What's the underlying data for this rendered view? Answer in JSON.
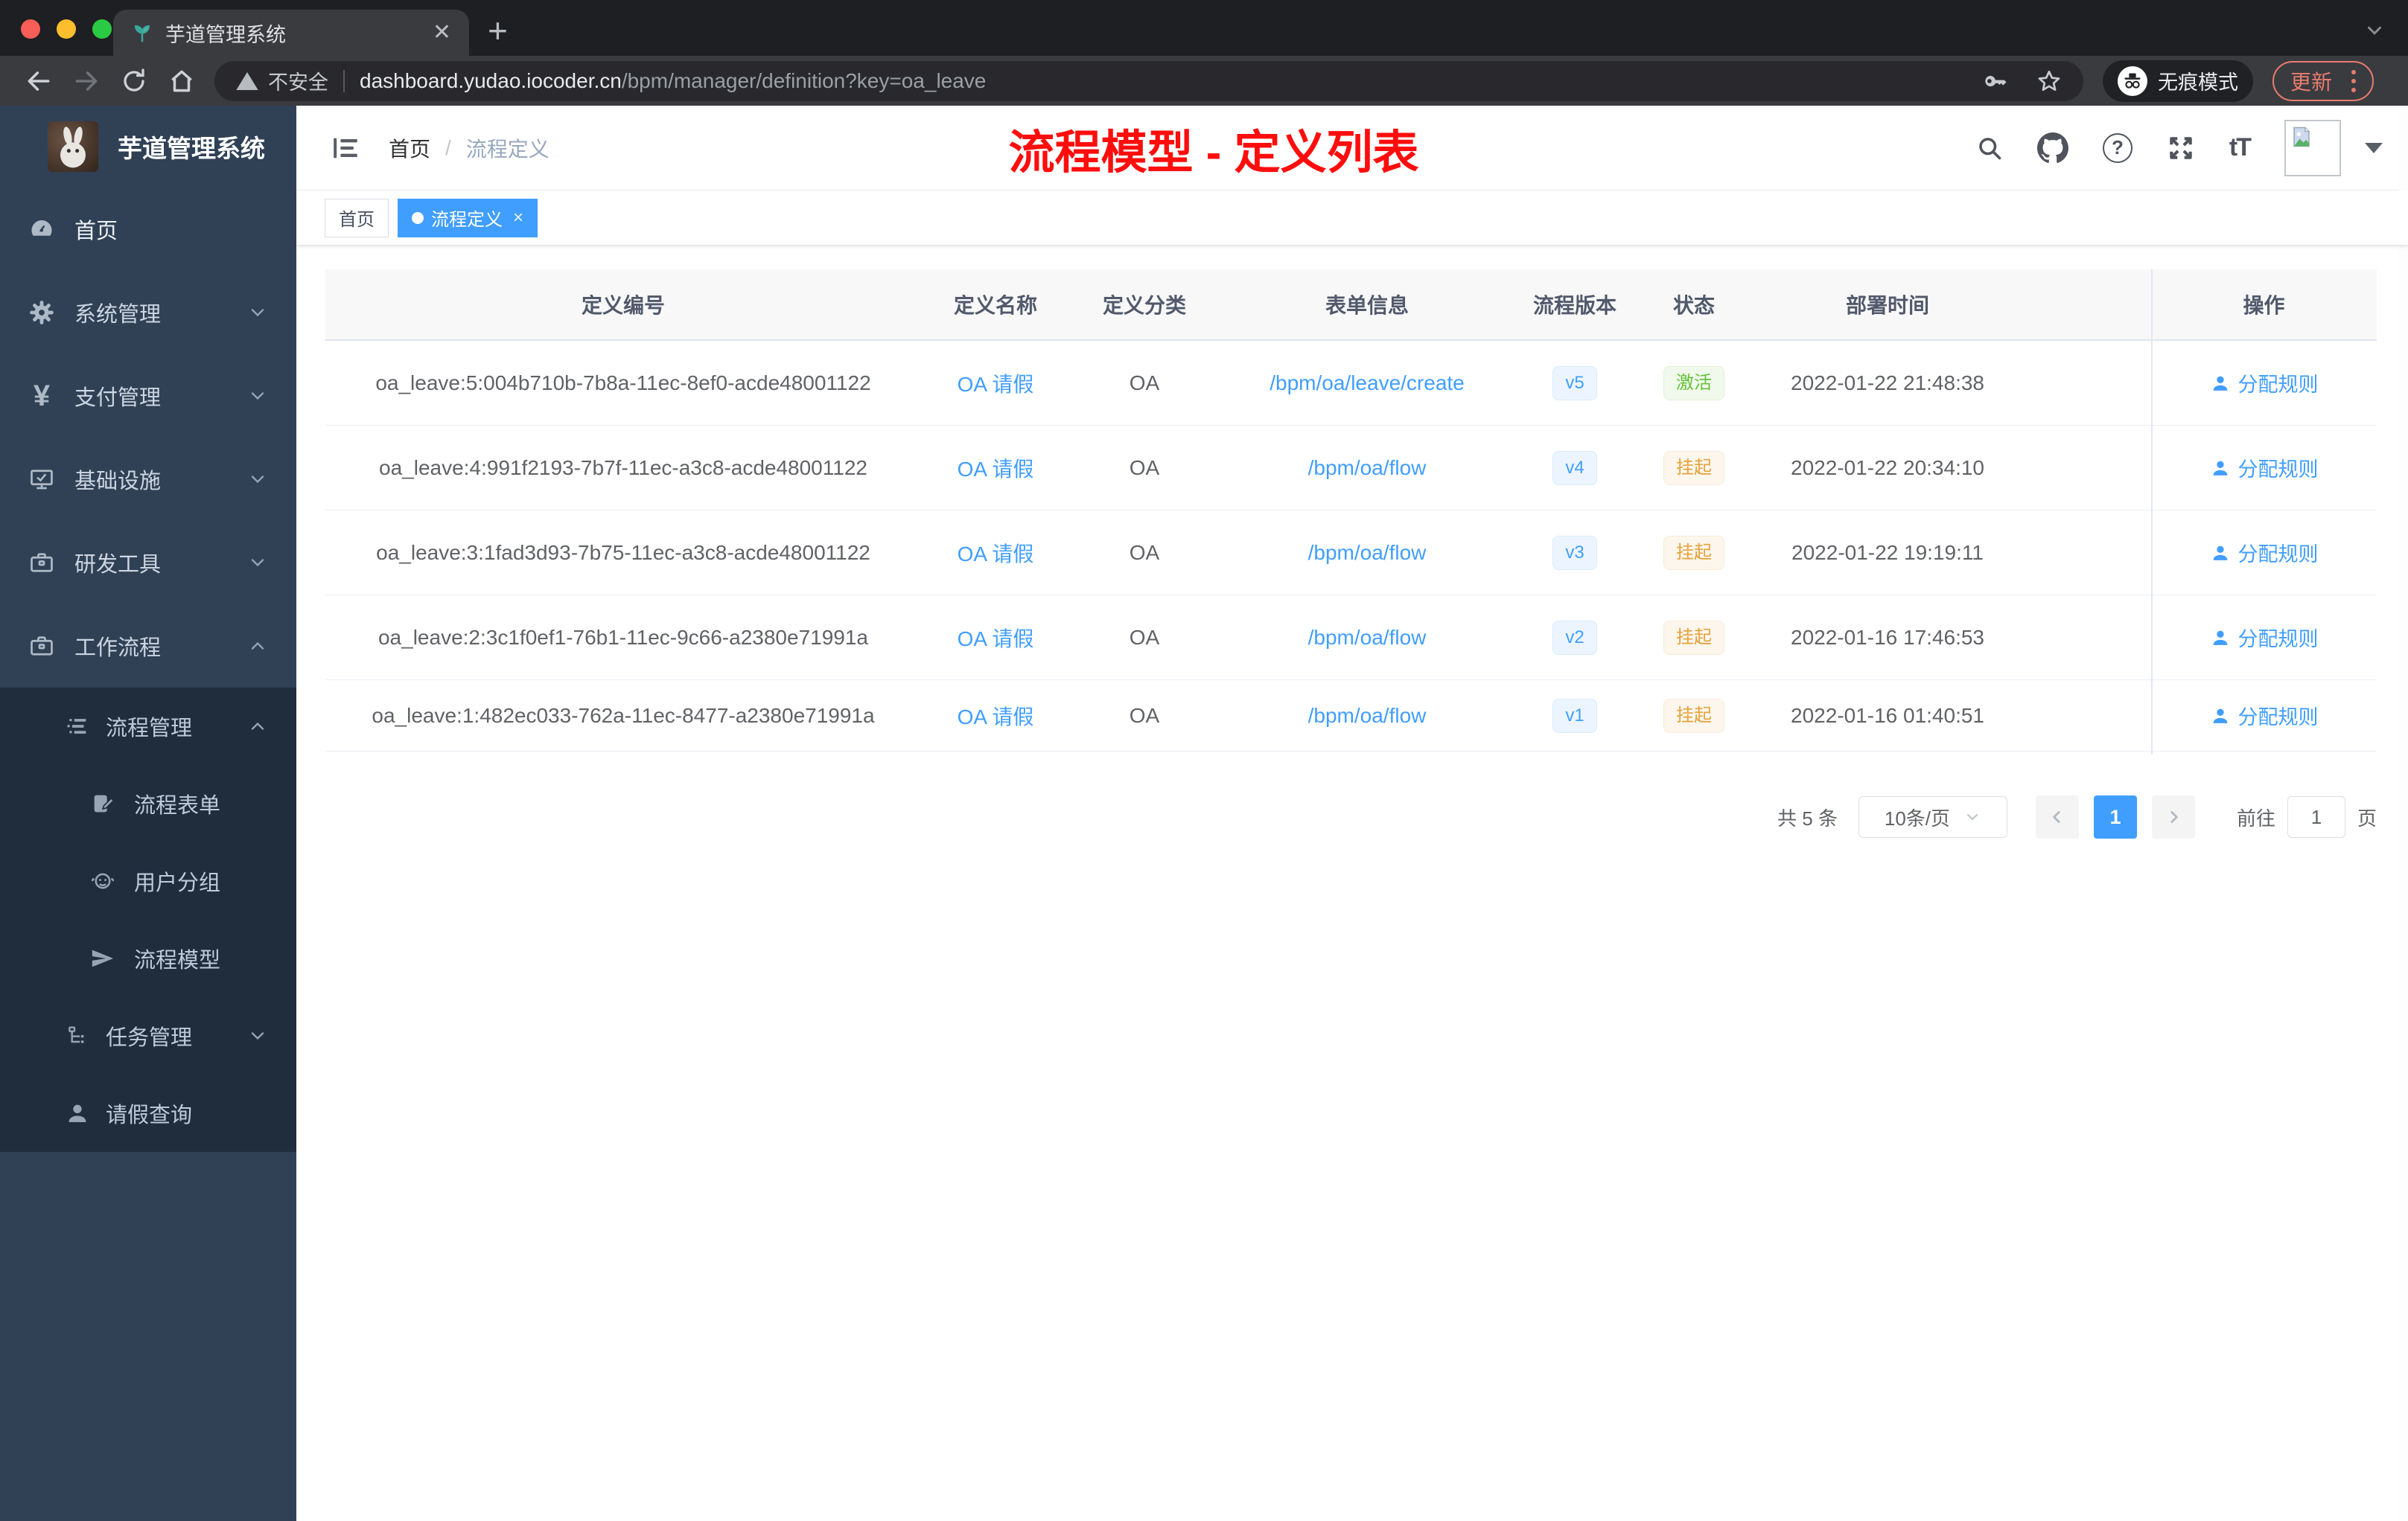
{
  "browser": {
    "tab_title": "芋道管理系统",
    "tab_close": "✕",
    "new_tab": "+",
    "security_label": "不安全",
    "url_host": "dashboard.yudao.iocoder.cn",
    "url_path": "/bpm/manager/definition?key=oa_leave",
    "incognito_label": "无痕模式",
    "update_label": "更新"
  },
  "sidebar": {
    "title": "芋道管理系统",
    "items": [
      {
        "label": "首页",
        "icon": "dashboard-icon",
        "chevron": "none"
      },
      {
        "label": "系统管理",
        "icon": "gear-icon",
        "chevron": "down"
      },
      {
        "label": "支付管理",
        "icon": "yuan-icon",
        "chevron": "down",
        "icon_glyph": "¥"
      },
      {
        "label": "基础设施",
        "icon": "monitor-icon",
        "chevron": "down"
      },
      {
        "label": "研发工具",
        "icon": "toolbox-icon",
        "chevron": "down"
      },
      {
        "label": "工作流程",
        "icon": "toolbox-icon",
        "chevron": "up"
      }
    ],
    "submenu": [
      {
        "label": "流程管理",
        "icon": "stream-icon",
        "chevron": "up"
      },
      {
        "label": "流程表单",
        "icon": "form-icon"
      },
      {
        "label": "用户分组",
        "icon": "user-group-icon"
      },
      {
        "label": "流程模型",
        "icon": "send-icon"
      },
      {
        "label": "任务管理",
        "icon": "tree-icon",
        "chevron": "down"
      },
      {
        "label": "请假查询",
        "icon": "person-icon"
      }
    ]
  },
  "header": {
    "breadcrumb": {
      "home": "首页",
      "separator": "/",
      "current": "流程定义"
    },
    "annotation": "流程模型 - 定义列表",
    "font_size_icon_label": "tT"
  },
  "tags": {
    "home": "首页",
    "active": "流程定义",
    "close": "×"
  },
  "table": {
    "columns": [
      "定义编号",
      "定义名称",
      "定义分类",
      "表单信息",
      "流程版本",
      "状态",
      "部署时间",
      "操作"
    ],
    "action_label": "分配规则",
    "rows": [
      {
        "id": "oa_leave:5:004b710b-7b8a-11ec-8ef0-acde48001122",
        "name": "OA 请假",
        "category": "OA",
        "form": "/bpm/oa/leave/create",
        "version": "v5",
        "status": "激活",
        "status_type": "active",
        "time": "2022-01-22 21:48:38"
      },
      {
        "id": "oa_leave:4:991f2193-7b7f-11ec-a3c8-acde48001122",
        "name": "OA 请假",
        "category": "OA",
        "form": "/bpm/oa/flow",
        "version": "v4",
        "status": "挂起",
        "status_type": "suspended",
        "time": "2022-01-22 20:34:10"
      },
      {
        "id": "oa_leave:3:1fad3d93-7b75-11ec-a3c8-acde48001122",
        "name": "OA 请假",
        "category": "OA",
        "form": "/bpm/oa/flow",
        "version": "v3",
        "status": "挂起",
        "status_type": "suspended",
        "time": "2022-01-22 19:19:11"
      },
      {
        "id": "oa_leave:2:3c1f0ef1-76b1-11ec-9c66-a2380e71991a",
        "name": "OA 请假",
        "category": "OA",
        "form": "/bpm/oa/flow",
        "version": "v2",
        "status": "挂起",
        "status_type": "suspended",
        "time": "2022-01-16 17:46:53"
      },
      {
        "id": "oa_leave:1:482ec033-762a-11ec-8477-a2380e71991a",
        "name": "OA 请假",
        "category": "OA",
        "form": "/bpm/oa/flow",
        "version": "v1",
        "status": "挂起",
        "status_type": "suspended",
        "time": "2022-01-16 01:40:51"
      }
    ]
  },
  "pagination": {
    "total": "共 5 条",
    "page_size": "10条/页",
    "current": "1",
    "goto_label": "前往",
    "goto_value": "1",
    "unit": "页"
  },
  "colors": {
    "accent": "#409eff",
    "status_active": "#67c23a",
    "status_suspended": "#e6a23c",
    "annotation_red": "#fe0d0d",
    "sidebar_bg": "#304156",
    "submenu_bg": "#1f2d3d"
  }
}
